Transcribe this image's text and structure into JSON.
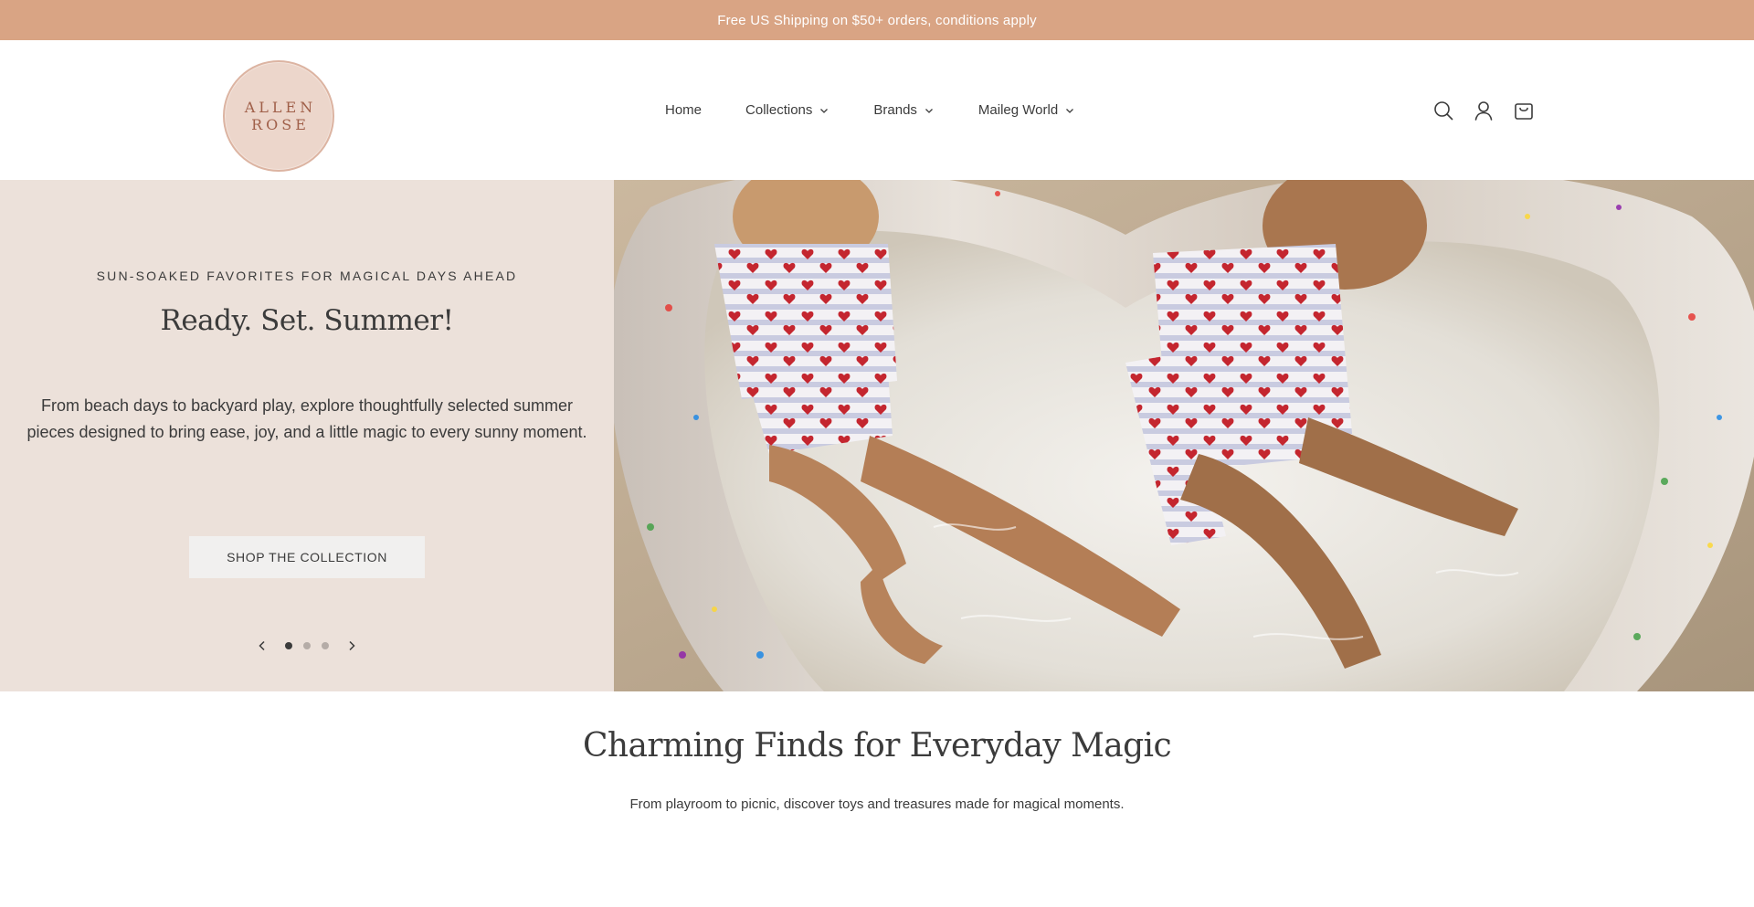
{
  "announcement": {
    "text": "Free US Shipping on $50+ orders, conditions apply"
  },
  "header": {
    "logo_line1": "ALLEN",
    "logo_line2": "ROSE",
    "nav": [
      {
        "label": "Home",
        "has_dropdown": false
      },
      {
        "label": "Collections",
        "has_dropdown": true
      },
      {
        "label": "Brands",
        "has_dropdown": true
      },
      {
        "label": "Maileg World",
        "has_dropdown": true
      }
    ],
    "icons": [
      "search-icon",
      "account-icon",
      "cart-icon"
    ]
  },
  "hero": {
    "eyebrow": "SUN-SOAKED FAVORITES FOR MAGICAL DAYS AHEAD",
    "title": "Ready. Set. Summer!",
    "body": "From beach days to backyard play, explore thoughtfully selected summer pieces designed to bring ease, joy, and a little magic to every sunny moment.",
    "cta": "SHOP THE COLLECTION",
    "slides_total": 3,
    "active_slide": 1,
    "image_description": "Two toddlers in red-heart striped swimwear sitting in a heart-shaped glitter inflatable pool",
    "colors": {
      "panel_bg": "#ece1da",
      "announce_bg": "#d9a484",
      "text": "#3b3b3b"
    }
  },
  "section": {
    "title": "Charming Finds for Everyday Magic",
    "subtitle": "From playroom to picnic, discover toys and treasures made for magical moments."
  }
}
